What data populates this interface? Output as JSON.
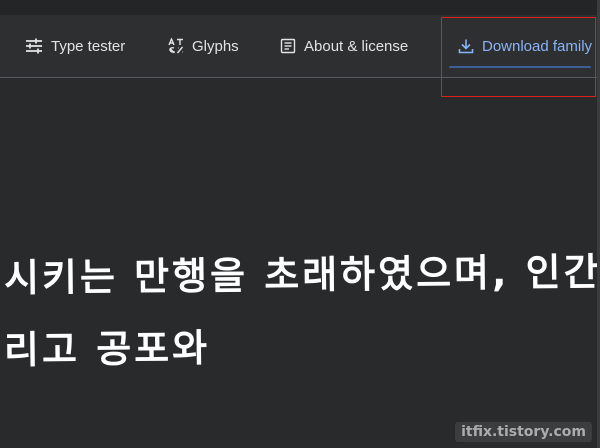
{
  "nav": {
    "items": [
      {
        "label": "Type tester",
        "icon": "tune-icon"
      },
      {
        "label": "Glyphs",
        "icon": "glyphs-icon"
      },
      {
        "label": "About & license",
        "icon": "article-icon"
      },
      {
        "label": "Download family",
        "icon": "download-icon"
      }
    ]
  },
  "preview": {
    "line1": "시키는 만행을 초래하였으며, 인간",
    "line2": "리고 공포와"
  },
  "watermark": "itfix.tistory.com",
  "colors": {
    "background": "#282a2c",
    "nav_text": "#e3e3e3",
    "accent": "#8ab4f8",
    "highlight": "#e0201c"
  }
}
